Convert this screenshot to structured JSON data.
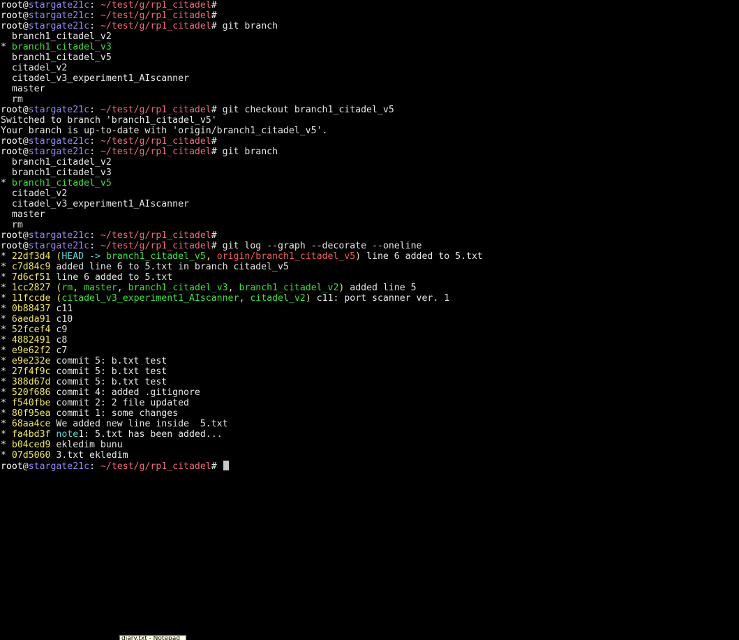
{
  "colors": {
    "user": "#ffffff",
    "host": "#9a86f2",
    "path": "#ec6a7c",
    "text": "#e6e6e6",
    "branch_current": "#3fe03f",
    "hash": "#f0e661",
    "ref_head": "#5fd7d7",
    "ref_remote": "#ec5f5f",
    "cursor": "#c8c8c8"
  },
  "terminal": {
    "lines": [
      [
        {
          "t": "root",
          "c": "user"
        },
        {
          "t": "@",
          "c": "text"
        },
        {
          "t": "stargate21c",
          "c": "host"
        },
        {
          "t": ": ",
          "c": "text"
        },
        {
          "t": "~/test/g/rp1_citadel",
          "c": "path"
        },
        {
          "t": "#",
          "c": "text"
        }
      ],
      [
        {
          "t": "root",
          "c": "user"
        },
        {
          "t": "@",
          "c": "text"
        },
        {
          "t": "stargate21c",
          "c": "host"
        },
        {
          "t": ": ",
          "c": "text"
        },
        {
          "t": "~/test/g/rp1_citadel",
          "c": "path"
        },
        {
          "t": "#",
          "c": "text"
        }
      ],
      [
        {
          "t": "root",
          "c": "user"
        },
        {
          "t": "@",
          "c": "text"
        },
        {
          "t": "stargate21c",
          "c": "host"
        },
        {
          "t": ": ",
          "c": "text"
        },
        {
          "t": "~/test/g/rp1_citadel",
          "c": "path"
        },
        {
          "t": "# git branch",
          "c": "text"
        }
      ],
      [
        {
          "t": "  branch1_citadel_v2",
          "c": "text"
        }
      ],
      [
        {
          "t": "* ",
          "c": "text"
        },
        {
          "t": "branch1_citadel_v3",
          "c": "branch_current"
        }
      ],
      [
        {
          "t": "  branch1_citadel_v5",
          "c": "text"
        }
      ],
      [
        {
          "t": "  citadel_v2",
          "c": "text"
        }
      ],
      [
        {
          "t": "  citadel_v3_experiment1_AIscanner",
          "c": "text"
        }
      ],
      [
        {
          "t": "  master",
          "c": "text"
        }
      ],
      [
        {
          "t": "  rm",
          "c": "text"
        }
      ],
      [
        {
          "t": "root",
          "c": "user"
        },
        {
          "t": "@",
          "c": "text"
        },
        {
          "t": "stargate21c",
          "c": "host"
        },
        {
          "t": ": ",
          "c": "text"
        },
        {
          "t": "~/test/g/rp1_citadel",
          "c": "path"
        },
        {
          "t": "# git checkout branch1_citadel_v5",
          "c": "text"
        }
      ],
      [
        {
          "t": "Switched to branch 'branch1_citadel_v5'",
          "c": "text"
        }
      ],
      [
        {
          "t": "Your branch is up-to-date with 'origin/branch1_citadel_v5'.",
          "c": "text"
        }
      ],
      [
        {
          "t": "root",
          "c": "user"
        },
        {
          "t": "@",
          "c": "text"
        },
        {
          "t": "stargate21c",
          "c": "host"
        },
        {
          "t": ": ",
          "c": "text"
        },
        {
          "t": "~/test/g/rp1_citadel",
          "c": "path"
        },
        {
          "t": "#",
          "c": "text"
        }
      ],
      [
        {
          "t": "root",
          "c": "user"
        },
        {
          "t": "@",
          "c": "text"
        },
        {
          "t": "stargate21c",
          "c": "host"
        },
        {
          "t": ": ",
          "c": "text"
        },
        {
          "t": "~/test/g/rp1_citadel",
          "c": "path"
        },
        {
          "t": "# git branch",
          "c": "text"
        }
      ],
      [
        {
          "t": "  branch1_citadel_v2",
          "c": "text"
        }
      ],
      [
        {
          "t": "  branch1_citadel_v3",
          "c": "text"
        }
      ],
      [
        {
          "t": "* ",
          "c": "text"
        },
        {
          "t": "branch1_citadel_v5",
          "c": "branch_current"
        }
      ],
      [
        {
          "t": "  citadel_v2",
          "c": "text"
        }
      ],
      [
        {
          "t": "  citadel_v3_experiment1_AIscanner",
          "c": "text"
        }
      ],
      [
        {
          "t": "  master",
          "c": "text"
        }
      ],
      [
        {
          "t": "  rm",
          "c": "text"
        }
      ],
      [
        {
          "t": "root",
          "c": "user"
        },
        {
          "t": "@",
          "c": "text"
        },
        {
          "t": "stargate21c",
          "c": "host"
        },
        {
          "t": ": ",
          "c": "text"
        },
        {
          "t": "~/test/g/rp1_citadel",
          "c": "path"
        },
        {
          "t": "#",
          "c": "text"
        }
      ],
      [
        {
          "t": "root",
          "c": "user"
        },
        {
          "t": "@",
          "c": "text"
        },
        {
          "t": "stargate21c",
          "c": "host"
        },
        {
          "t": ": ",
          "c": "text"
        },
        {
          "t": "~/test/g/rp1_citadel",
          "c": "path"
        },
        {
          "t": "# git log --graph --decorate --oneline",
          "c": "text"
        }
      ],
      [
        {
          "t": "* ",
          "c": "text"
        },
        {
          "t": "22df3d4",
          "c": "hash"
        },
        {
          "t": " (",
          "c": "hash"
        },
        {
          "t": "HEAD -> ",
          "c": "ref_head"
        },
        {
          "t": "branch1_citadel_v5",
          "c": "branch_current"
        },
        {
          "t": ", ",
          "c": "hash"
        },
        {
          "t": "origin/branch1_citadel_v5",
          "c": "ref_remote"
        },
        {
          "t": ")",
          "c": "hash"
        },
        {
          "t": " line 6 added to 5.txt",
          "c": "text"
        }
      ],
      [
        {
          "t": "* ",
          "c": "text"
        },
        {
          "t": "c7d84c9",
          "c": "hash"
        },
        {
          "t": " added line 6 to 5.txt in branch citadel_v5",
          "c": "text"
        }
      ],
      [
        {
          "t": "* ",
          "c": "text"
        },
        {
          "t": "7d6cf51",
          "c": "hash"
        },
        {
          "t": " line 6 added to 5.txt",
          "c": "text"
        }
      ],
      [
        {
          "t": "* ",
          "c": "text"
        },
        {
          "t": "1cc2827",
          "c": "hash"
        },
        {
          "t": " (",
          "c": "hash"
        },
        {
          "t": "rm",
          "c": "branch_current"
        },
        {
          "t": ", ",
          "c": "hash"
        },
        {
          "t": "master",
          "c": "branch_current"
        },
        {
          "t": ", ",
          "c": "hash"
        },
        {
          "t": "branch1_citadel_v3",
          "c": "branch_current"
        },
        {
          "t": ", ",
          "c": "hash"
        },
        {
          "t": "branch1_citadel_v2",
          "c": "branch_current"
        },
        {
          "t": ")",
          "c": "hash"
        },
        {
          "t": " added line 5",
          "c": "text"
        }
      ],
      [
        {
          "t": "* ",
          "c": "text"
        },
        {
          "t": "11fccde",
          "c": "hash"
        },
        {
          "t": " (",
          "c": "hash"
        },
        {
          "t": "citadel_v3_experiment1_AIscanner",
          "c": "branch_current"
        },
        {
          "t": ", ",
          "c": "hash"
        },
        {
          "t": "citadel_v2",
          "c": "branch_current"
        },
        {
          "t": ")",
          "c": "hash"
        },
        {
          "t": " c11: port scanner ver. 1",
          "c": "text"
        }
      ],
      [
        {
          "t": "* ",
          "c": "text"
        },
        {
          "t": "0b88437",
          "c": "hash"
        },
        {
          "t": " c11",
          "c": "text"
        }
      ],
      [
        {
          "t": "* ",
          "c": "text"
        },
        {
          "t": "6aeda91",
          "c": "hash"
        },
        {
          "t": " c10",
          "c": "text"
        }
      ],
      [
        {
          "t": "* ",
          "c": "text"
        },
        {
          "t": "52fcef4",
          "c": "hash"
        },
        {
          "t": " c9",
          "c": "text"
        }
      ],
      [
        {
          "t": "* ",
          "c": "text"
        },
        {
          "t": "4882491",
          "c": "hash"
        },
        {
          "t": " c8",
          "c": "text"
        }
      ],
      [
        {
          "t": "* ",
          "c": "text"
        },
        {
          "t": "e9e62f2",
          "c": "hash"
        },
        {
          "t": " c7",
          "c": "text"
        }
      ],
      [
        {
          "t": "* ",
          "c": "text"
        },
        {
          "t": "e9e232e",
          "c": "hash"
        },
        {
          "t": " commit 5: b.txt test",
          "c": "text"
        }
      ],
      [
        {
          "t": "* ",
          "c": "text"
        },
        {
          "t": "27f4f9c",
          "c": "hash"
        },
        {
          "t": " commit 5: b.txt test",
          "c": "text"
        }
      ],
      [
        {
          "t": "* ",
          "c": "text"
        },
        {
          "t": "388d67d",
          "c": "hash"
        },
        {
          "t": " commit 5: b.txt test",
          "c": "text"
        }
      ],
      [
        {
          "t": "* ",
          "c": "text"
        },
        {
          "t": "520f686",
          "c": "hash"
        },
        {
          "t": " commit 4: added .gitignore",
          "c": "text"
        }
      ],
      [
        {
          "t": "* ",
          "c": "text"
        },
        {
          "t": "f540fbe",
          "c": "hash"
        },
        {
          "t": " commit 2: 2 file updated",
          "c": "text"
        }
      ],
      [
        {
          "t": "* ",
          "c": "text"
        },
        {
          "t": "80f95ea",
          "c": "hash"
        },
        {
          "t": " commit 1: some changes",
          "c": "text"
        }
      ],
      [
        {
          "t": "* ",
          "c": "text"
        },
        {
          "t": "68aa4ce",
          "c": "hash"
        },
        {
          "t": " We added new line inside  5.txt",
          "c": "text"
        }
      ],
      [
        {
          "t": "* ",
          "c": "text"
        },
        {
          "t": "fa4bd3f",
          "c": "hash"
        },
        {
          "t": " ",
          "c": "text"
        },
        {
          "t": "note",
          "c": "ref_head"
        },
        {
          "t": "1: 5.txt has been added...",
          "c": "text"
        }
      ],
      [
        {
          "t": "* ",
          "c": "text"
        },
        {
          "t": "b04ced9",
          "c": "hash"
        },
        {
          "t": " ekledim bunu",
          "c": "text"
        }
      ],
      [
        {
          "t": "* ",
          "c": "text"
        },
        {
          "t": "07d5060",
          "c": "hash"
        },
        {
          "t": " 3.txt ekledim",
          "c": "text"
        }
      ],
      [
        {
          "t": "root",
          "c": "user"
        },
        {
          "t": "@",
          "c": "text"
        },
        {
          "t": "stargate21c",
          "c": "host"
        },
        {
          "t": ": ",
          "c": "text"
        },
        {
          "t": "~/test/g/rp1_citadel",
          "c": "path"
        },
        {
          "t": "# ",
          "c": "text"
        }
      ]
    ]
  },
  "taskbar_tooltip": "diary.txt - Notepad"
}
